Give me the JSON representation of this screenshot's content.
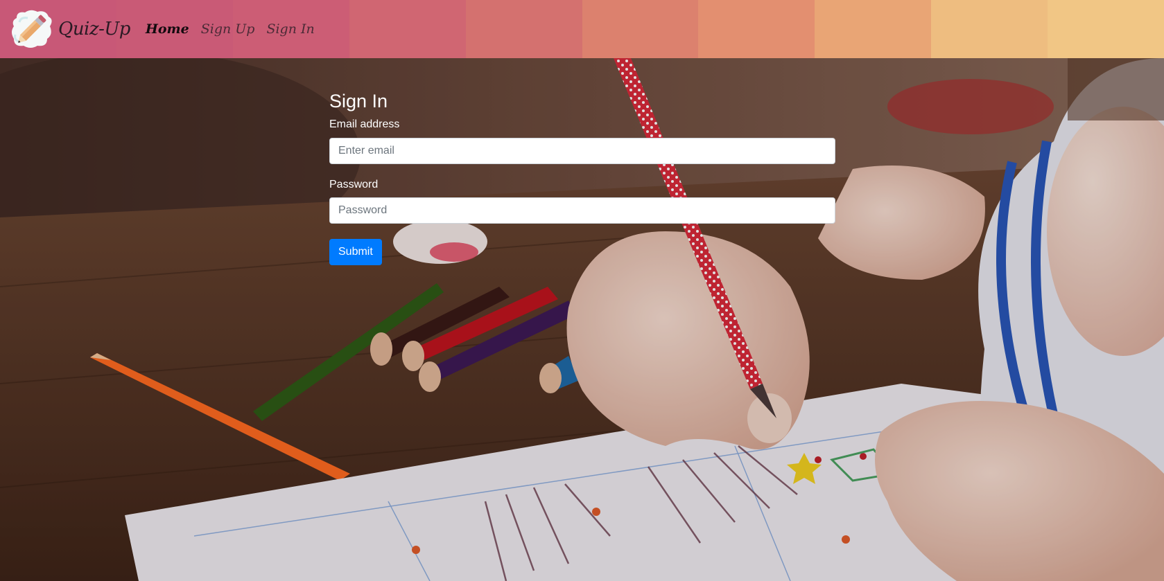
{
  "navbar": {
    "brand": "Quiz-Up",
    "links": [
      {
        "label": "Home",
        "active": true
      },
      {
        "label": "Sign Up",
        "active": false
      },
      {
        "label": "Sign In",
        "active": false
      }
    ],
    "stripe_colors": [
      "#c85877",
      "#c95a76",
      "#cc5d75",
      "#d06672",
      "#d4716f",
      "#dc816e",
      "#e38f70",
      "#e9a575",
      "#eebd80",
      "#f1c685"
    ]
  },
  "form": {
    "title": "Sign In",
    "email": {
      "label": "Email address",
      "placeholder": "Enter email",
      "value": ""
    },
    "password": {
      "label": "Password",
      "placeholder": "Password",
      "value": ""
    },
    "submit_label": "Submit"
  },
  "colors": {
    "accent": "#007bff",
    "form_text": "#ffffff"
  }
}
